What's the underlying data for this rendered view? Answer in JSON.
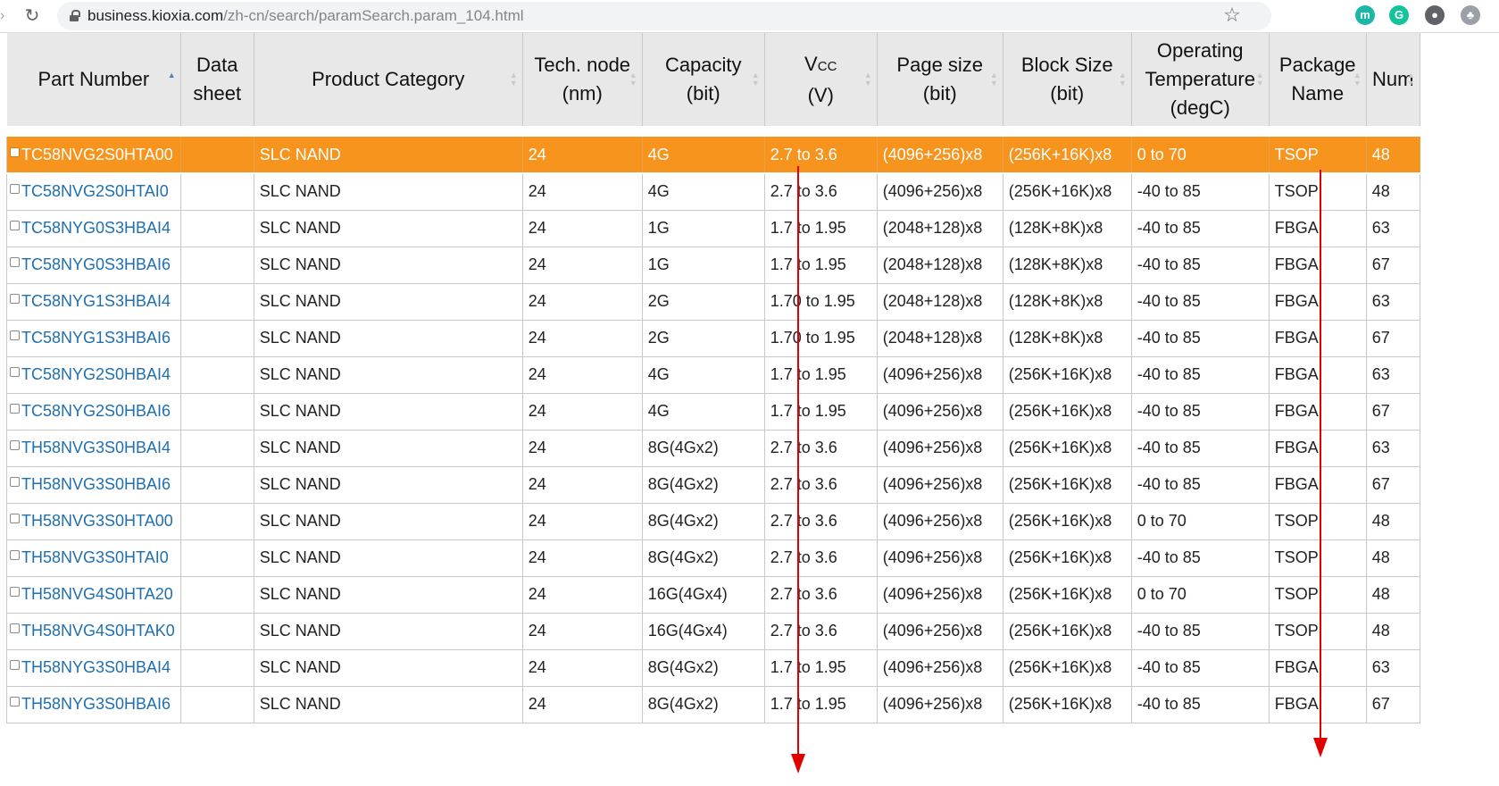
{
  "browser": {
    "url_host": "business.kioxia.com",
    "url_path": "/zh-cn/search/paramSearch.param_104.html",
    "extensions": [
      {
        "name": "teal-extension-icon",
        "color": "#1db7a8",
        "glyph": "m"
      },
      {
        "name": "grammarly-icon",
        "color": "#15c39a",
        "glyph": "G"
      },
      {
        "name": "incognito-icon",
        "color": "#5f6368",
        "glyph": "●"
      },
      {
        "name": "puzzle-extension-icon",
        "color": "#9aa0a6",
        "glyph": "♣"
      }
    ]
  },
  "colors": {
    "selected_row": "#f7941d",
    "header_bg": "#e8e8e8",
    "link": "#1f6fb0",
    "annotation_arrow": "#e00000"
  },
  "table": {
    "columns": [
      {
        "key": "part_number",
        "lines": [
          "Part Number"
        ],
        "sortable": true,
        "sorted": "asc"
      },
      {
        "key": "datasheet",
        "lines": [
          "Data",
          "sheet"
        ],
        "sortable": false
      },
      {
        "key": "product_category",
        "lines": [
          "Product Category"
        ],
        "sortable": true
      },
      {
        "key": "tech_node",
        "lines": [
          "Tech. node",
          "(nm)"
        ],
        "sortable": true
      },
      {
        "key": "capacity",
        "lines": [
          "Capacity",
          "(bit)"
        ],
        "sortable": true
      },
      {
        "key": "vcc",
        "lines": [
          "VCC",
          "(V)"
        ],
        "sortable": true
      },
      {
        "key": "page_size",
        "lines": [
          "Page size",
          "(bit)"
        ],
        "sortable": true
      },
      {
        "key": "block_size",
        "lines": [
          "Block Size",
          "(bit)"
        ],
        "sortable": true
      },
      {
        "key": "operating_temperature",
        "lines": [
          "Operating",
          "Temperature",
          "(degC)"
        ],
        "sortable": true
      },
      {
        "key": "package_name",
        "lines": [
          "Package",
          "Name"
        ],
        "sortable": true
      },
      {
        "key": "num",
        "lines": [
          "Num"
        ],
        "sortable": true
      }
    ],
    "rows": [
      {
        "part_number": "TC58NVG2S0HTA00",
        "datasheet": "",
        "product_category": "SLC NAND",
        "tech_node": "24",
        "capacity": "4G",
        "vcc": "2.7 to 3.6",
        "page_size": "(4096+256)x8",
        "block_size": "(256K+16K)x8",
        "operating_temperature": "0 to 70",
        "package_name": "TSOP",
        "num": "48",
        "selected": true
      },
      {
        "part_number": "TC58NVG2S0HTAI0",
        "datasheet": "",
        "product_category": "SLC NAND",
        "tech_node": "24",
        "capacity": "4G",
        "vcc": "2.7 to 3.6",
        "page_size": "(4096+256)x8",
        "block_size": "(256K+16K)x8",
        "operating_temperature": "-40 to 85",
        "package_name": "TSOP",
        "num": "48"
      },
      {
        "part_number": "TC58NYG0S3HBAI4",
        "datasheet": "",
        "product_category": "SLC NAND",
        "tech_node": "24",
        "capacity": "1G",
        "vcc": "1.7 to 1.95",
        "page_size": "(2048+128)x8",
        "block_size": "(128K+8K)x8",
        "operating_temperature": "-40 to 85",
        "package_name": "FBGA",
        "num": "63"
      },
      {
        "part_number": "TC58NYG0S3HBAI6",
        "datasheet": "",
        "product_category": "SLC NAND",
        "tech_node": "24",
        "capacity": "1G",
        "vcc": "1.7 to 1.95",
        "page_size": "(2048+128)x8",
        "block_size": "(128K+8K)x8",
        "operating_temperature": "-40 to 85",
        "package_name": "FBGA",
        "num": "67"
      },
      {
        "part_number": "TC58NYG1S3HBAI4",
        "datasheet": "",
        "product_category": "SLC NAND",
        "tech_node": "24",
        "capacity": "2G",
        "vcc": "1.70 to 1.95",
        "page_size": "(2048+128)x8",
        "block_size": "(128K+8K)x8",
        "operating_temperature": "-40 to 85",
        "package_name": "FBGA",
        "num": "63"
      },
      {
        "part_number": "TC58NYG1S3HBAI6",
        "datasheet": "",
        "product_category": "SLC NAND",
        "tech_node": "24",
        "capacity": "2G",
        "vcc": "1.70 to 1.95",
        "page_size": "(2048+128)x8",
        "block_size": "(128K+8K)x8",
        "operating_temperature": "-40 to 85",
        "package_name": "FBGA",
        "num": "67"
      },
      {
        "part_number": "TC58NYG2S0HBAI4",
        "datasheet": "",
        "product_category": "SLC NAND",
        "tech_node": "24",
        "capacity": "4G",
        "vcc": "1.7 to 1.95",
        "page_size": "(4096+256)x8",
        "block_size": "(256K+16K)x8",
        "operating_temperature": "-40 to 85",
        "package_name": "FBGA",
        "num": "63"
      },
      {
        "part_number": "TC58NYG2S0HBAI6",
        "datasheet": "",
        "product_category": "SLC NAND",
        "tech_node": "24",
        "capacity": "4G",
        "vcc": "1.7 to 1.95",
        "page_size": "(4096+256)x8",
        "block_size": "(256K+16K)x8",
        "operating_temperature": "-40 to 85",
        "package_name": "FBGA",
        "num": "67"
      },
      {
        "part_number": "TH58NVG3S0HBAI4",
        "datasheet": "",
        "product_category": "SLC NAND",
        "tech_node": "24",
        "capacity": "8G(4Gx2)",
        "vcc": "2.7 to 3.6",
        "page_size": "(4096+256)x8",
        "block_size": "(256K+16K)x8",
        "operating_temperature": "-40 to 85",
        "package_name": "FBGA",
        "num": "63"
      },
      {
        "part_number": "TH58NVG3S0HBAI6",
        "datasheet": "",
        "product_category": "SLC NAND",
        "tech_node": "24",
        "capacity": "8G(4Gx2)",
        "vcc": "2.7 to 3.6",
        "page_size": "(4096+256)x8",
        "block_size": "(256K+16K)x8",
        "operating_temperature": "-40 to 85",
        "package_name": "FBGA",
        "num": "67"
      },
      {
        "part_number": "TH58NVG3S0HTA00",
        "datasheet": "",
        "product_category": "SLC NAND",
        "tech_node": "24",
        "capacity": "8G(4Gx2)",
        "vcc": "2.7 to 3.6",
        "page_size": "(4096+256)x8",
        "block_size": "(256K+16K)x8",
        "operating_temperature": "0 to 70",
        "package_name": "TSOP",
        "num": "48"
      },
      {
        "part_number": "TH58NVG3S0HTAI0",
        "datasheet": "",
        "product_category": "SLC NAND",
        "tech_node": "24",
        "capacity": "8G(4Gx2)",
        "vcc": "2.7 to 3.6",
        "page_size": "(4096+256)x8",
        "block_size": "(256K+16K)x8",
        "operating_temperature": "-40 to 85",
        "package_name": "TSOP",
        "num": "48"
      },
      {
        "part_number": "TH58NVG4S0HTA20",
        "datasheet": "",
        "product_category": "SLC NAND",
        "tech_node": "24",
        "capacity": "16G(4Gx4)",
        "vcc": "2.7 to 3.6",
        "page_size": "(4096+256)x8",
        "block_size": "(256K+16K)x8",
        "operating_temperature": "0 to 70",
        "package_name": "TSOP",
        "num": "48"
      },
      {
        "part_number": "TH58NVG4S0HTAK0",
        "datasheet": "",
        "product_category": "SLC NAND",
        "tech_node": "24",
        "capacity": "16G(4Gx4)",
        "vcc": "2.7 to 3.6",
        "page_size": "(4096+256)x8",
        "block_size": "(256K+16K)x8",
        "operating_temperature": "-40 to 85",
        "package_name": "TSOP",
        "num": "48"
      },
      {
        "part_number": "TH58NYG3S0HBAI4",
        "datasheet": "",
        "product_category": "SLC NAND",
        "tech_node": "24",
        "capacity": "8G(4Gx2)",
        "vcc": "1.7 to 1.95",
        "page_size": "(4096+256)x8",
        "block_size": "(256K+16K)x8",
        "operating_temperature": "-40 to 85",
        "package_name": "FBGA",
        "num": "63"
      },
      {
        "part_number": "TH58NYG3S0HBAI6",
        "datasheet": "",
        "product_category": "SLC NAND",
        "tech_node": "24",
        "capacity": "8G(4Gx2)",
        "vcc": "1.7 to 1.95",
        "page_size": "(4096+256)x8",
        "block_size": "(256K+16K)x8",
        "operating_temperature": "-40 to 85",
        "package_name": "FBGA",
        "num": "67"
      }
    ]
  }
}
